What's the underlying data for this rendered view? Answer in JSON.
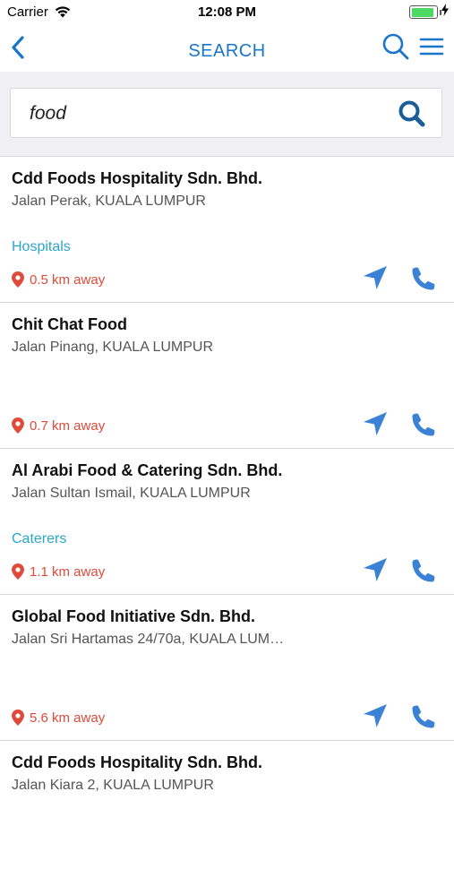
{
  "status_bar": {
    "carrier": "Carrier",
    "time": "12:08 PM"
  },
  "nav": {
    "title": "SEARCH"
  },
  "search": {
    "value": "food"
  },
  "results": [
    {
      "name": "Cdd Foods Hospitality Sdn. Bhd.",
      "address": "Jalan Perak, KUALA LUMPUR",
      "category": "Hospitals",
      "distance": "0.5 km away"
    },
    {
      "name": "Chit Chat Food",
      "address": "Jalan Pinang, KUALA LUMPUR",
      "category": "",
      "distance": "0.7 km away"
    },
    {
      "name": "Al Arabi Food & Catering Sdn. Bhd.",
      "address": "Jalan Sultan Ismail, KUALA LUMPUR",
      "category": "Caterers",
      "distance": "1.1 km away"
    },
    {
      "name": "Global Food Initiative Sdn. Bhd.",
      "address": "Jalan Sri Hartamas 24/70a, KUALA LUM…",
      "category": "",
      "distance": "5.6 km away"
    },
    {
      "name": "Cdd Foods Hospitality Sdn. Bhd.",
      "address": "Jalan Kiara 2, KUALA LUMPUR",
      "category": "",
      "distance": ""
    }
  ],
  "icons": {
    "back": "chevron-left-icon",
    "search": "search-icon",
    "menu": "hamburger-menu-icon",
    "directions": "navigation-arrow-icon",
    "call": "phone-icon",
    "location": "location-pin-icon"
  },
  "colors": {
    "accent": "#1976c8",
    "category": "#2aa6c8",
    "distance": "#e04a3a",
    "action_icon": "#3b82d6",
    "battery": "#4cd964"
  }
}
